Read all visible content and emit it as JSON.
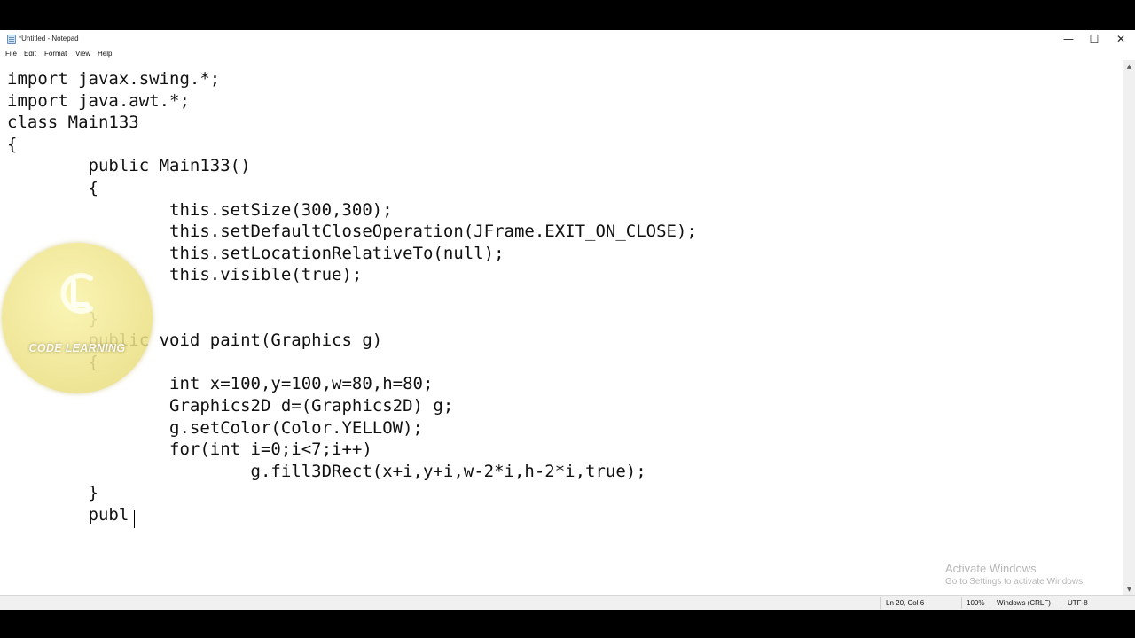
{
  "window": {
    "title": "*Untitled - Notepad",
    "controls": {
      "minimize": "—",
      "maximize": "☐",
      "close": "✕"
    }
  },
  "menu": [
    "File",
    "Edit",
    "Format",
    "View",
    "Help"
  ],
  "editor": {
    "lines": [
      "import javax.swing.*;",
      "import java.awt.*;",
      "class Main133",
      "{",
      "        public Main133()",
      "        {",
      "                this.setSize(300,300);",
      "                this.setDefaultCloseOperation(JFrame.EXIT_ON_CLOSE);",
      "                this.setLocationRelativeTo(null);",
      "                this.visible(true);",
      "",
      "        }",
      "        public void paint(Graphics g)",
      "        {",
      "                int x=100,y=100,w=80,h=80;",
      "                Graphics2D d=(Graphics2D) g;",
      "                g.setColor(Color.YELLOW);",
      "                for(int i=0;i<7;i++)",
      "                        g.fill3DRect(x+i,y+i,w-2*i,h-2*i,true);",
      "        }",
      "        publ"
    ]
  },
  "statusbar": {
    "position": "Ln 20, Col 6",
    "zoom": "100%",
    "line_ending": "Windows (CRLF)",
    "encoding": "UTF-8"
  },
  "activation_watermark": {
    "title": "Activate Windows",
    "subtitle": "Go to Settings to activate Windows."
  },
  "logo": {
    "text": "CODE LEARNING",
    "icon": "code-learning-logo"
  }
}
